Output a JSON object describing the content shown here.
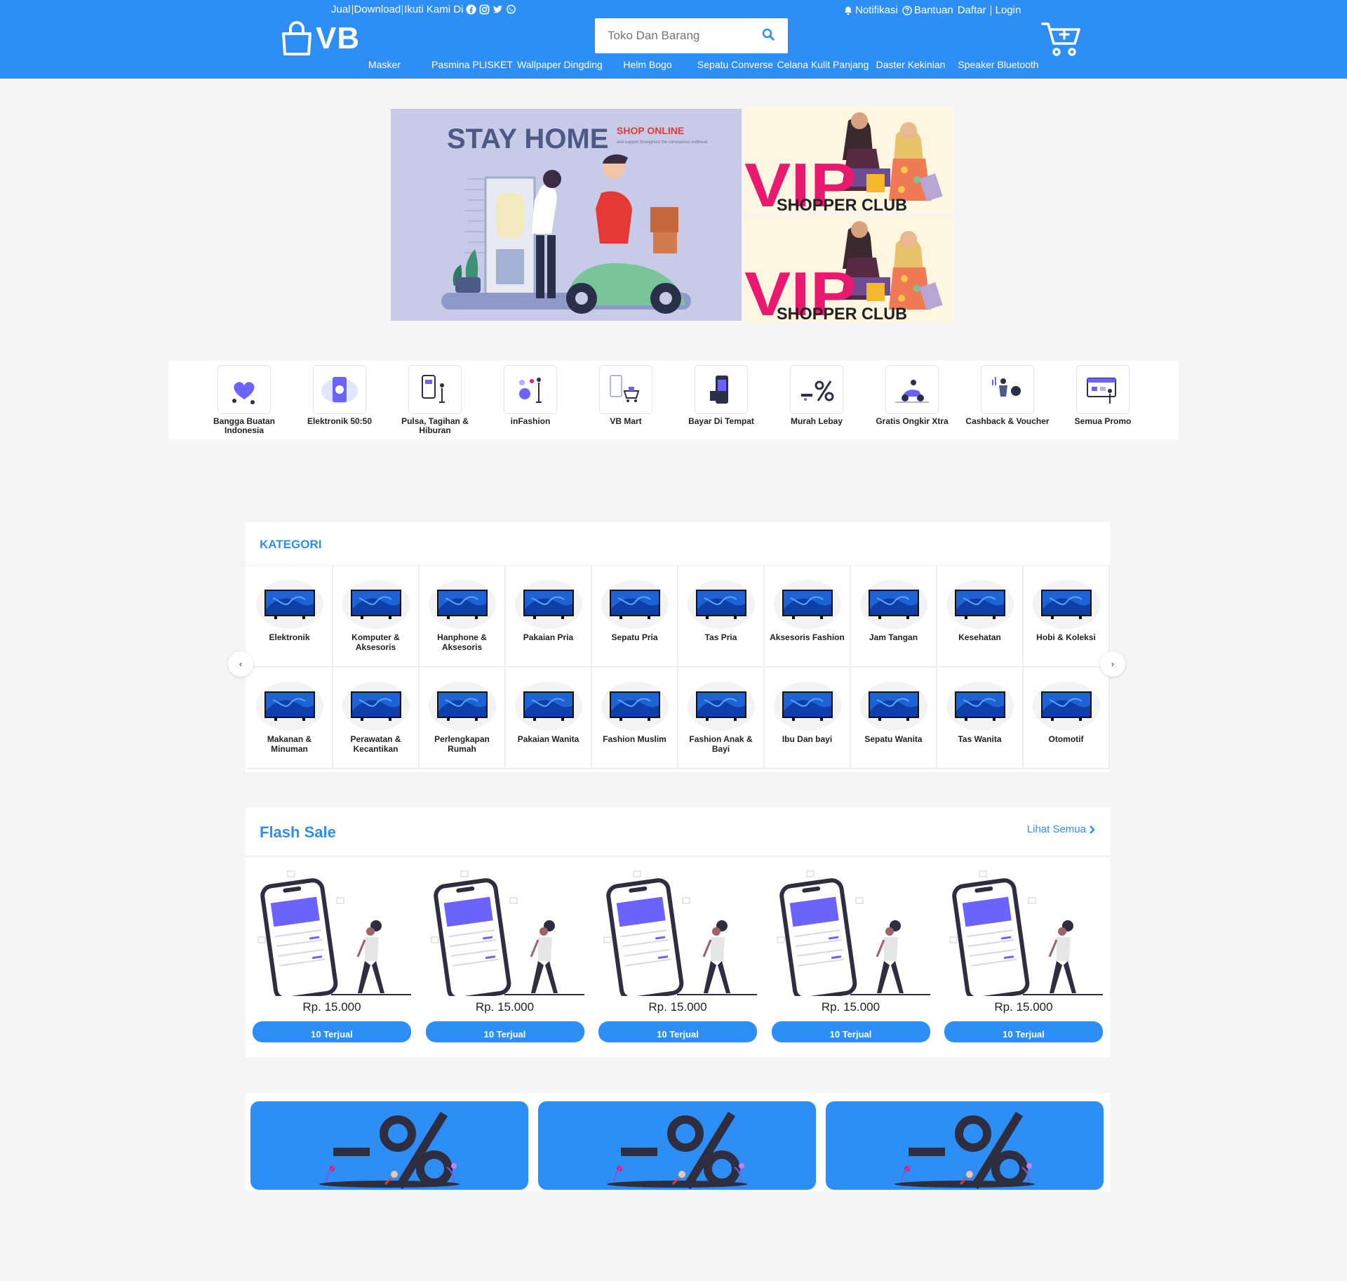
{
  "header": {
    "top_left": {
      "sell": "Jual",
      "download": "Download",
      "follow": "Ikuti Kami Di"
    },
    "social_icons": [
      "facebook-icon",
      "instagram-icon",
      "twitter-icon",
      "whatsapp-icon"
    ],
    "top_right": {
      "notifications": "Notifikasi",
      "help": "Bantuan",
      "register": "Daftar",
      "login": "Login"
    },
    "logo_text": "VB",
    "search": {
      "placeholder": "Toko Dan Barang"
    },
    "nav_links": [
      "Masker",
      "Pasmina PLISKET",
      "Wallpaper Dingding",
      "Helm Bogo",
      "Sepatu Converse",
      "Celana Kulit Panjang",
      "Daster Kekinian",
      "Speaker Bluetooth"
    ]
  },
  "banner": {
    "main": {
      "title": "STAY HOME",
      "tag": "SHOP ONLINE",
      "tagline": "and support throughout the coronavirus outbreak"
    },
    "side": [
      {
        "title": "VIP",
        "subtitle": "SHOPPER CLUB"
      },
      {
        "title": "VIP",
        "subtitle": "SHOPPER CLUB"
      }
    ]
  },
  "quick_menu": [
    "Bangga Buatan Indonesia",
    "Elektronik 50:50",
    "Pulsa, Tagihan & Hiburan",
    "inFashion",
    "VB Mart",
    "Bayar Di Tempat",
    "Murah Lebay",
    "Gratis Ongkir Xtra",
    "Cashback & Voucher",
    "Semua Promo"
  ],
  "kategori": {
    "title": "KATEGORI",
    "prev": "‹",
    "next": "›",
    "items": [
      "Elektronik",
      "Komputer & Aksesoris",
      "Hanphone & Aksesoris",
      "Pakaian Pria",
      "Sepatu Pria",
      "Tas Pria",
      "Aksesoris Fashion",
      "Jam Tangan",
      "Kesehatan",
      "Hobi & Koleksi",
      "Makanan & Minuman",
      "Perawatan & Kecantikan",
      "Perlengkapan Rumah",
      "Pakaian Wanita",
      "Fashion Muslim",
      "Fashion Anak & Bayi",
      "Ibu Dan bayi",
      "Sepatu Wanita",
      "Tas Wanita",
      "Otomotif"
    ]
  },
  "flash_sale": {
    "title": "Flash Sale",
    "see_all": "Lihat Semua",
    "products": [
      {
        "price": "Rp. 15.000",
        "sold": "10 Terjual"
      },
      {
        "price": "Rp. 15.000",
        "sold": "10 Terjual"
      },
      {
        "price": "Rp. 15.000",
        "sold": "10 Terjual"
      },
      {
        "price": "Rp. 15.000",
        "sold": "10 Terjual"
      },
      {
        "price": "Rp. 15.000",
        "sold": "10 Terjual"
      }
    ]
  },
  "promo_banners": 3,
  "colors": {
    "brand_blue": "#2d8ff5",
    "accent_purple": "#6c63ff",
    "vip_pink": "#e8196e",
    "page_bg": "#f5f5f5"
  }
}
